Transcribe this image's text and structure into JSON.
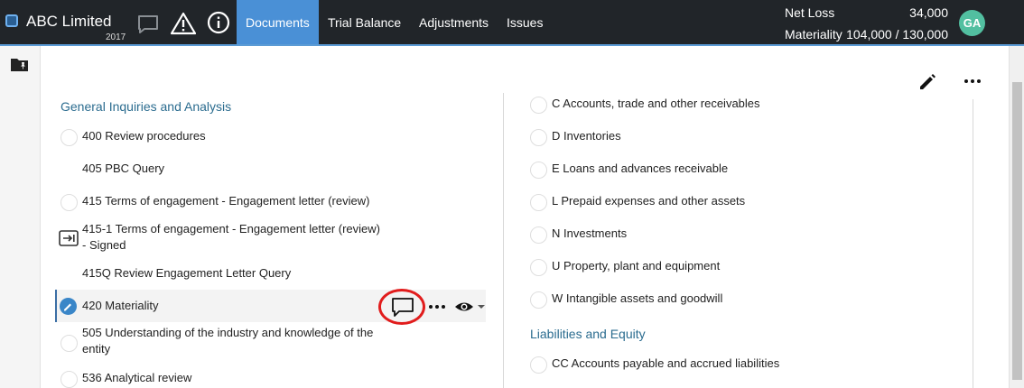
{
  "header": {
    "company": "ABC Limited",
    "year": "2017",
    "icons": [
      "comment-icon",
      "warning-icon",
      "info-icon"
    ],
    "tabs": [
      {
        "label": "Documents",
        "active": true
      },
      {
        "label": "Trial Balance",
        "active": false
      },
      {
        "label": "Adjustments",
        "active": false
      },
      {
        "label": "Issues",
        "active": false
      }
    ],
    "net_loss_label": "Net Loss",
    "net_loss_value": "34,000",
    "materiality_label": "Materiality",
    "materiality_value": "104,000 / 130,000",
    "user_initials": "GA"
  },
  "colors": {
    "topbar": "#212529",
    "active_tab": "#4a90d6",
    "section_title": "#2b6c8f",
    "avatar": "#52bfa0",
    "highlight_ring": "#e11c1c"
  },
  "left_column": {
    "section_title": "General Inquiries and Analysis",
    "items": [
      {
        "label": "400 Review procedures"
      },
      {
        "label": "405 PBC Query"
      },
      {
        "label": "415 Terms of engagement - Engagement letter (review)"
      },
      {
        "label_line1": "415-1 Terms of engagement - Engagement letter (review)",
        "label_line2": "- Signed"
      },
      {
        "label": "415Q Review Engagement Letter Query"
      },
      {
        "label": "420 Materiality"
      },
      {
        "label_line1": "505 Understanding of the industry and knowledge of the",
        "label_line2": "entity"
      },
      {
        "label": "536 Analytical review"
      }
    ]
  },
  "right_column": {
    "items_top": [
      {
        "label": "C Accounts, trade and other receivables"
      },
      {
        "label": "D Inventories"
      },
      {
        "label": "E Loans and advances receivable"
      },
      {
        "label": "L Prepaid expenses and other assets"
      },
      {
        "label": "N Investments"
      },
      {
        "label": "U Property, plant and equipment"
      },
      {
        "label": "W Intangible assets and goodwill"
      }
    ],
    "section_title": "Liabilities and Equity",
    "items_bottom": [
      {
        "label": "CC Accounts payable and accrued liabilities"
      }
    ]
  }
}
